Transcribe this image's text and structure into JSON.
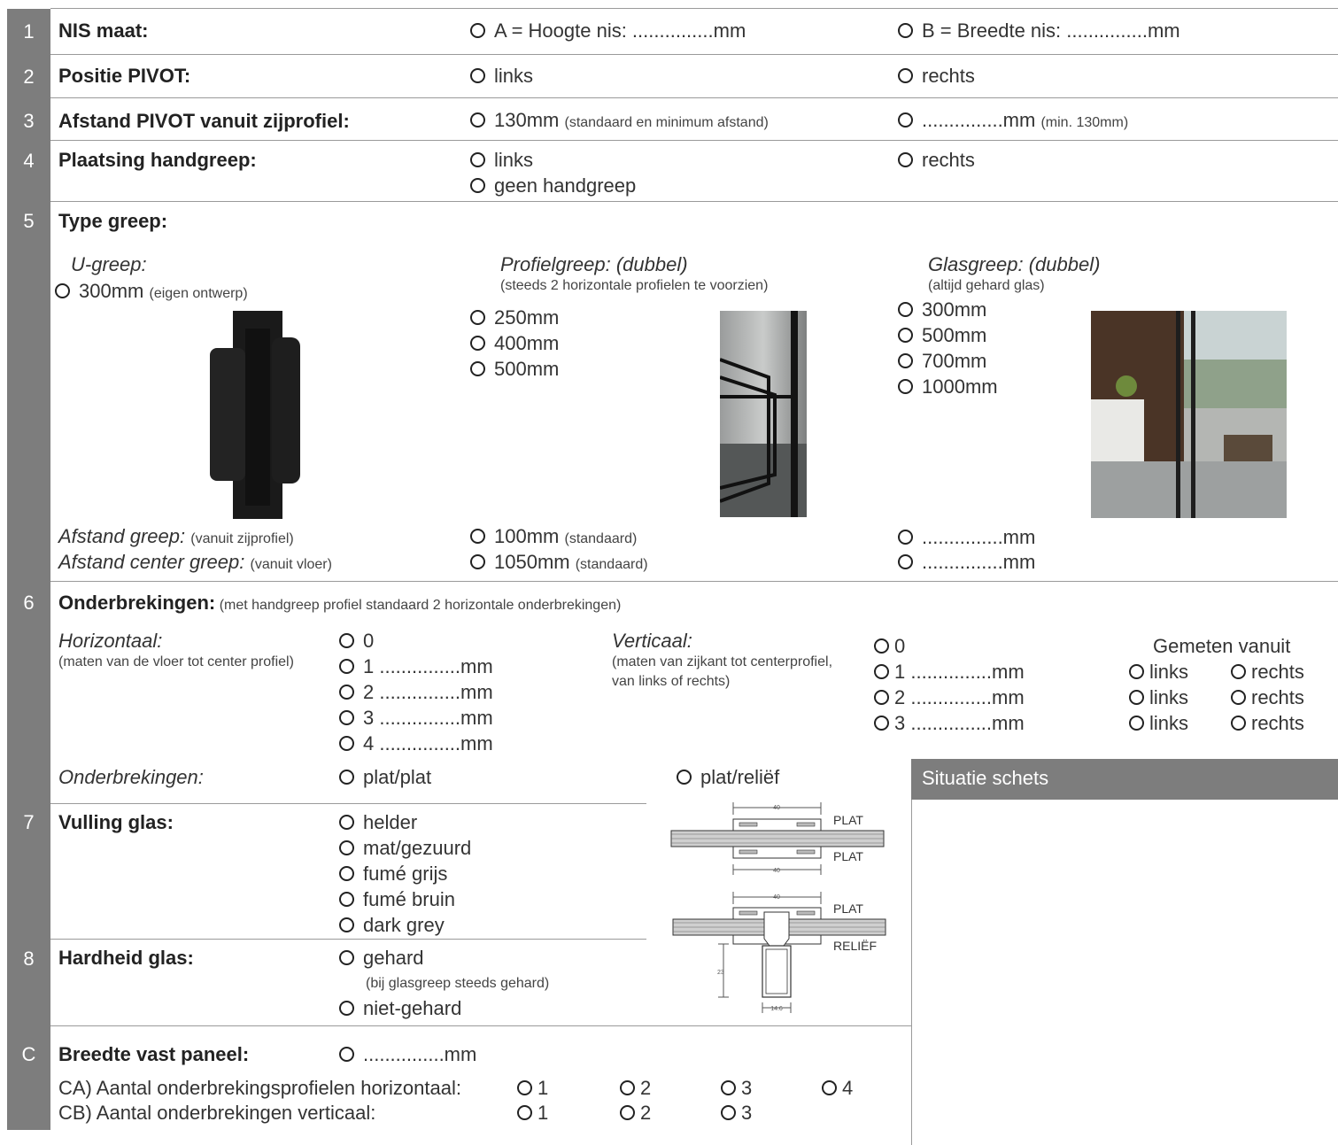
{
  "rows": {
    "r1": {
      "num": "1",
      "label": "NIS maat:",
      "a": "A = Hoogte nis: ...............mm",
      "b": "B = Breedte nis: ...............mm"
    },
    "r2": {
      "num": "2",
      "label": "Positie PIVOT:",
      "a": "links",
      "b": "rechts"
    },
    "r3": {
      "num": "3",
      "label": "Afstand PIVOT vanuit zijprofiel:",
      "a": "130mm",
      "a_note": "(standaard en minimum afstand)",
      "b": "...............mm",
      "b_note": "(min. 130mm)"
    },
    "r4": {
      "num": "4",
      "label": "Plaatsing handgreep:",
      "a": "links",
      "a2": "geen handgreep",
      "b": "rechts"
    },
    "r5": {
      "num": "5",
      "label": "Type greep:",
      "u_title": "U-greep:",
      "u_opt": "300mm",
      "u_note": "(eigen ontwerp)",
      "p_title": "Profielgreep: (dubbel)",
      "p_note": "(steeds 2 horizontale profielen te voorzien)",
      "p_opts": [
        "250mm",
        "400mm",
        "500mm"
      ],
      "g_title": "Glasgreep: (dubbel)",
      "g_note": "(altijd gehard glas)",
      "g_opts": [
        "300mm",
        "500mm",
        "700mm",
        "1000mm"
      ],
      "afstand_label": "Afstand greep:",
      "afstand_note": "(vanuit zijprofiel)",
      "center_label": "Afstand center greep:",
      "center_note": "(vanuit vloer)",
      "afstand_opt": "100mm",
      "afstand_opt_note": "(standaard)",
      "center_opt": "1050mm",
      "center_opt_note": "(standaard)",
      "custom1": "...............mm",
      "custom2": "...............mm"
    },
    "r6": {
      "num": "6",
      "label": "Onderbrekingen:",
      "note": "(met handgreep profiel standaard 2 horizontale onderbrekingen)",
      "h_title": "Horizontaal:",
      "h_note": "(maten van de vloer tot center profiel)",
      "h_opts": [
        "0",
        "1 ...............mm",
        "2 ...............mm",
        "3 ...............mm",
        "4 ...............mm"
      ],
      "v_title": "Verticaal:",
      "v_note1": "(maten van zijkant tot centerprofiel,",
      "v_note2": "van links of rechts)",
      "v_opts": [
        "0",
        "1 ...............mm",
        "2 ...............mm",
        "3 ...............mm"
      ],
      "gemeten": "Gemeten vanuit",
      "links": "links",
      "rechts": "rechts",
      "ond_label": "Onderbrekingen:",
      "ond_a": "plat/plat",
      "ond_b": "plat/reliëf"
    },
    "r7": {
      "num": "7",
      "label": "Vulling glas:",
      "opts": [
        "helder",
        "mat/gezuurd",
        "fumé grijs",
        "fumé bruin",
        "dark grey"
      ]
    },
    "r8": {
      "num": "8",
      "label": "Hardheid glas:",
      "a": "gehard",
      "note": "(bij glasgreep steeds gehard)",
      "b": "niet-gehard"
    },
    "rc": {
      "num": "C",
      "label": "Breedte vast paneel:",
      "a": "...............mm",
      "ca": "CA) Aantal onderbrekingsprofielen horizontaal:",
      "ca_opts": [
        "1",
        "2",
        "3",
        "4"
      ],
      "cb": "CB) Aantal onderbrekingen verticaal:",
      "cb_opts": [
        "1",
        "2",
        "3"
      ]
    }
  },
  "sketch_title": "Situatie schets",
  "profile": {
    "plat": "PLAT",
    "relief": "RELIËF",
    "dim40": "40",
    "dim23": "23",
    "dim146": "14.6"
  },
  "colors": {
    "sidebar": "#7d7d7d",
    "header": "#7d7d7d"
  }
}
